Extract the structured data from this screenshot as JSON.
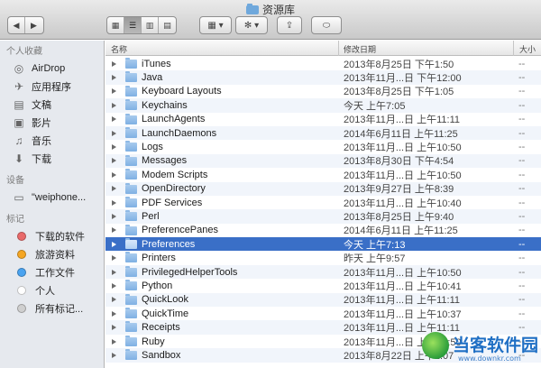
{
  "window": {
    "title": "资源库"
  },
  "toolbar": {
    "back": "◀",
    "forward": "▶",
    "view_icon": "▦",
    "view_list": "☰",
    "view_columns": "▥",
    "view_coverflow": "▤",
    "arrange": "▦ ▾",
    "action": "✻ ▾",
    "share": "⇪",
    "tag": "⬭"
  },
  "sidebar": {
    "favorites_header": "个人收藏",
    "favorites": [
      {
        "label": "AirDrop",
        "icon": "airdrop-icon",
        "glyph": "◎"
      },
      {
        "label": "应用程序",
        "icon": "applications-icon",
        "glyph": "✈"
      },
      {
        "label": "文稿",
        "icon": "documents-icon",
        "glyph": "▤"
      },
      {
        "label": "影片",
        "icon": "movies-icon",
        "glyph": "▣"
      },
      {
        "label": "音乐",
        "icon": "music-icon",
        "glyph": "♫"
      },
      {
        "label": "下载",
        "icon": "downloads-icon",
        "glyph": "⬇"
      }
    ],
    "devices_header": "设备",
    "devices": [
      {
        "label": "\"weiphone...",
        "icon": "computer-icon",
        "glyph": "▭"
      }
    ],
    "tags_header": "标记",
    "tags": [
      {
        "label": "下载的软件",
        "color": "#e96a6a"
      },
      {
        "label": "旅游资料",
        "color": "#f5a623"
      },
      {
        "label": "工作文件",
        "color": "#4aa3f0"
      },
      {
        "label": "个人",
        "color": "#ffffff"
      },
      {
        "label": "所有标记...",
        "color": "#cfcfcf"
      }
    ]
  },
  "columns": {
    "name": "名称",
    "modified": "修改日期",
    "size": "大小"
  },
  "rows": [
    {
      "name": "iTunes",
      "date": "2013年8月25日 下午1:50",
      "size": "--"
    },
    {
      "name": "Java",
      "date": "2013年11月...日 下午12:00",
      "size": "--"
    },
    {
      "name": "Keyboard Layouts",
      "date": "2013年8月25日 下午1:05",
      "size": "--"
    },
    {
      "name": "Keychains",
      "date": "今天 上午7:05",
      "size": "--"
    },
    {
      "name": "LaunchAgents",
      "date": "2013年11月...日 上午11:11",
      "size": "--"
    },
    {
      "name": "LaunchDaemons",
      "date": "2014年6月11日 上午11:25",
      "size": "--"
    },
    {
      "name": "Logs",
      "date": "2013年11月...日 上午10:50",
      "size": "--"
    },
    {
      "name": "Messages",
      "date": "2013年8月30日 下午4:54",
      "size": "--"
    },
    {
      "name": "Modem Scripts",
      "date": "2013年11月...日 上午10:50",
      "size": "--"
    },
    {
      "name": "OpenDirectory",
      "date": "2013年9月27日 上午8:39",
      "size": "--"
    },
    {
      "name": "PDF Services",
      "date": "2013年11月...日 上午10:40",
      "size": "--"
    },
    {
      "name": "Perl",
      "date": "2013年8月25日 上午9:40",
      "size": "--"
    },
    {
      "name": "PreferencePanes",
      "date": "2014年6月11日 上午11:25",
      "size": "--"
    },
    {
      "name": "Preferences",
      "date": "今天 上午7:13",
      "size": "--",
      "selected": true
    },
    {
      "name": "Printers",
      "date": "昨天 上午9:57",
      "size": "--"
    },
    {
      "name": "PrivilegedHelperTools",
      "date": "2013年11月...日 上午10:50",
      "size": "--"
    },
    {
      "name": "Python",
      "date": "2013年11月...日 上午10:41",
      "size": "--"
    },
    {
      "name": "QuickLook",
      "date": "2013年11月...日 上午11:11",
      "size": "--"
    },
    {
      "name": "QuickTime",
      "date": "2013年11月...日 上午10:37",
      "size": "--"
    },
    {
      "name": "Receipts",
      "date": "2013年11月...日 上午11:11",
      "size": "--"
    },
    {
      "name": "Ruby",
      "date": "2013年11月...日 上午10:50",
      "size": "--"
    },
    {
      "name": "Sandbox",
      "date": "2013年8月22日 上午1:07",
      "size": "--"
    }
  ],
  "watermark": {
    "text": "当客软件园",
    "url": "www.downkr.com"
  }
}
